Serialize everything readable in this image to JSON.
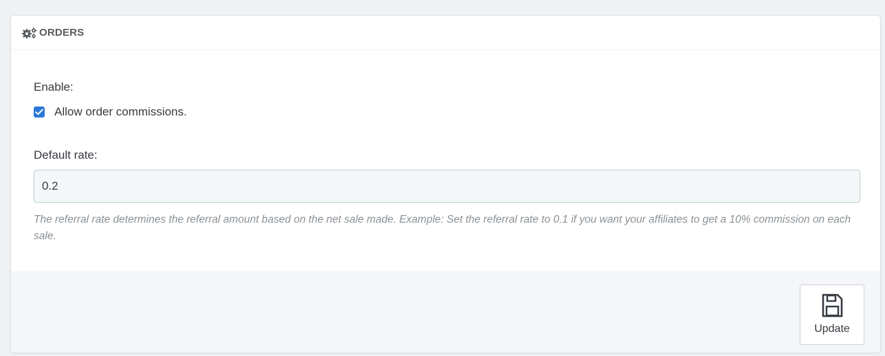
{
  "panel": {
    "title": "ORDERS",
    "heading_icon": "cogs-icon"
  },
  "form": {
    "enable_label": "Enable:",
    "checkbox_label": "Allow order commissions.",
    "checkbox_checked": true,
    "rate_label": "Default rate:",
    "rate_value": "0.2",
    "help_text": "The referral rate determines the referral amount based on the net sale made. Example: Set the referral rate to 0.1 if you want your affiliates to get a 10% commission on each sale."
  },
  "footer": {
    "update_label": "Update",
    "update_icon": "save-icon"
  },
  "colors": {
    "accent": "#2c78d6",
    "background": "#eff1f2",
    "input_bg": "#f5f8f9",
    "help_text": "#8b9196"
  }
}
